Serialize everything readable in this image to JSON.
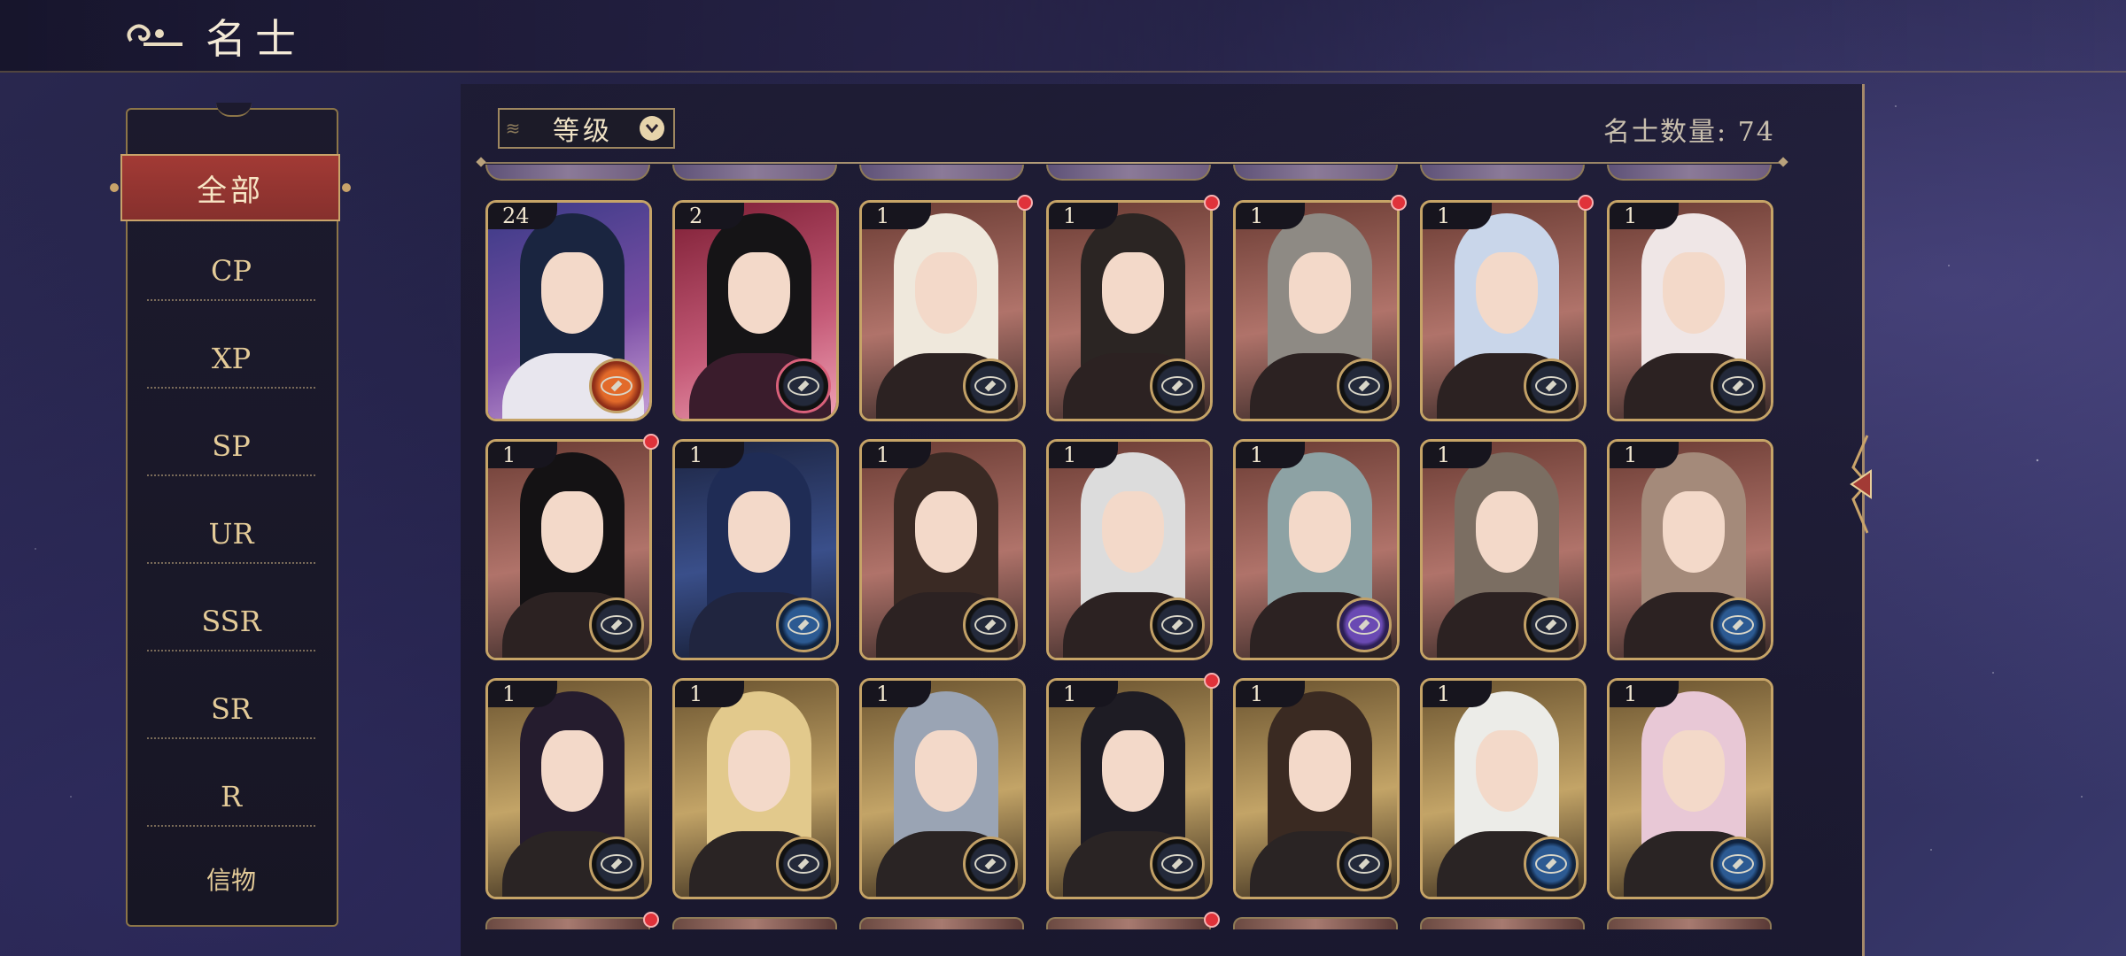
{
  "header": {
    "title": "名士",
    "title_icon": "cloud-swirl-icon"
  },
  "sidebar": {
    "categories": [
      {
        "label": "全部",
        "active": true
      },
      {
        "label": "CP"
      },
      {
        "label": "XP"
      },
      {
        "label": "SP"
      },
      {
        "label": "UR"
      },
      {
        "label": "SSR"
      },
      {
        "label": "SR"
      },
      {
        "label": "R"
      },
      {
        "label": "信物"
      }
    ]
  },
  "toolbar": {
    "sort_label": "等级",
    "count_label": "名士数量: 74"
  },
  "colors": {
    "accent_red": "#a23a35",
    "gold_border": "#c6a467",
    "notification_dot": "#e0323a",
    "background": "#1d1c3c"
  },
  "cards": [
    {
      "level": "24",
      "faction": "red-orb",
      "notify": false,
      "theme": "indigo"
    },
    {
      "level": "2",
      "faction": "compass",
      "notify": false,
      "theme": "crimson"
    },
    {
      "level": "1",
      "faction": "compass",
      "notify": true,
      "theme": "copper"
    },
    {
      "level": "1",
      "faction": "compass",
      "notify": true,
      "theme": "copper"
    },
    {
      "level": "1",
      "faction": "compass",
      "notify": true,
      "theme": "copper"
    },
    {
      "level": "1",
      "faction": "compass",
      "notify": true,
      "theme": "copper"
    },
    {
      "level": "1",
      "faction": "compass",
      "notify": false,
      "theme": "copper"
    },
    {
      "level": "1",
      "faction": "compass",
      "notify": true,
      "theme": "copper"
    },
    {
      "level": "1",
      "faction": "blue-compass",
      "notify": false,
      "theme": "navy"
    },
    {
      "level": "1",
      "faction": "compass",
      "notify": false,
      "theme": "copper"
    },
    {
      "level": "1",
      "faction": "compass",
      "notify": false,
      "theme": "copper"
    },
    {
      "level": "1",
      "faction": "purple-planet",
      "notify": false,
      "theme": "copper"
    },
    {
      "level": "1",
      "faction": "compass",
      "notify": false,
      "theme": "copper"
    },
    {
      "level": "1",
      "faction": "blue-compass",
      "notify": false,
      "theme": "copper"
    },
    {
      "level": "1",
      "faction": "compass",
      "notify": false,
      "theme": "gold"
    },
    {
      "level": "1",
      "faction": "compass",
      "notify": false,
      "theme": "gold"
    },
    {
      "level": "1",
      "faction": "compass",
      "notify": false,
      "theme": "gold"
    },
    {
      "level": "1",
      "faction": "compass",
      "notify": true,
      "theme": "gold"
    },
    {
      "level": "1",
      "faction": "compass",
      "notify": false,
      "theme": "gold"
    },
    {
      "level": "1",
      "faction": "blue-compass",
      "notify": false,
      "theme": "gold"
    },
    {
      "level": "1",
      "faction": "blue-compass",
      "notify": false,
      "theme": "gold"
    }
  ]
}
